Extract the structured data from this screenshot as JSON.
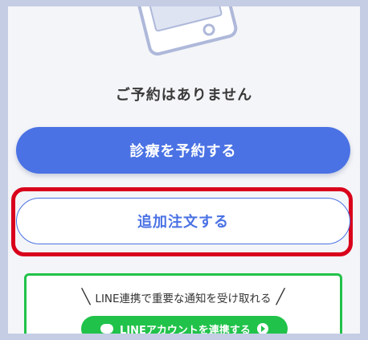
{
  "empty_state": {
    "message": "ご予約はありません",
    "illustration_icon": "smartphone-illustration"
  },
  "buttons": {
    "reserve_label": "診療を予約する",
    "additional_order_label": "追加注文する"
  },
  "line_section": {
    "caption": "LINE連携で重要な通知を受け取れる",
    "button_label": "LINEアカウントを連携する",
    "icons": [
      "line-chat-icon",
      "arrow-circle-icon"
    ]
  },
  "colors": {
    "primary": "#4a72e4",
    "line_green": "#21c24a",
    "highlight_red": "#d9001b",
    "background": "#f4f5f8",
    "outer": "#c5cde4"
  }
}
